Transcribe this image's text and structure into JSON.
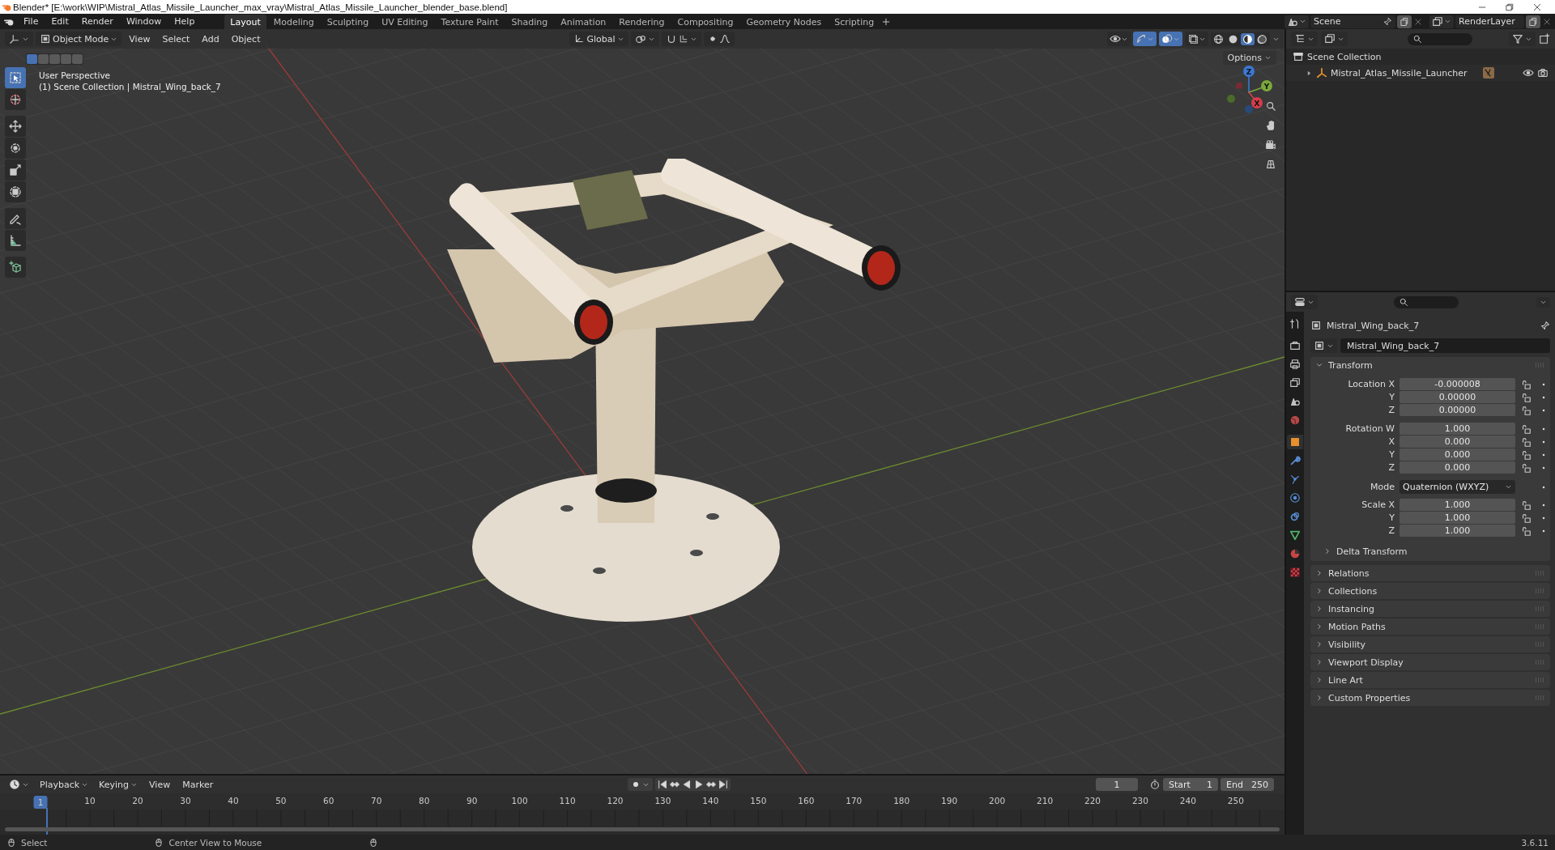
{
  "window": {
    "title": "Blender* [E:\\work\\WIP\\Mistral_Atlas_Missile_Launcher_max_vray\\Mistral_Atlas_Missile_Launcher_blender_base.blend]"
  },
  "menu": [
    "File",
    "Edit",
    "Render",
    "Window",
    "Help"
  ],
  "workspaces": [
    {
      "label": "Layout",
      "selected": true
    },
    {
      "label": "Modeling",
      "selected": false
    },
    {
      "label": "Sculpting",
      "selected": false
    },
    {
      "label": "UV Editing",
      "selected": false
    },
    {
      "label": "Texture Paint",
      "selected": false
    },
    {
      "label": "Shading",
      "selected": false
    },
    {
      "label": "Animation",
      "selected": false
    },
    {
      "label": "Rendering",
      "selected": false
    },
    {
      "label": "Compositing",
      "selected": false
    },
    {
      "label": "Geometry Nodes",
      "selected": false
    },
    {
      "label": "Scripting",
      "selected": false
    }
  ],
  "scene": {
    "name": "Scene"
  },
  "view_layer": {
    "name": "RenderLayer"
  },
  "viewport": {
    "mode": "Object Mode",
    "menus": [
      "View",
      "Select",
      "Add",
      "Object"
    ],
    "orientation": "Global",
    "options": "Options",
    "view_name": "User Perspective",
    "context": "(1) Scene Collection | Mistral_Wing_back_7",
    "select_modes": [
      {
        "selected": true
      },
      {
        "selected": false
      },
      {
        "selected": false
      },
      {
        "selected": false
      },
      {
        "selected": false
      }
    ],
    "tools": [
      {
        "kind": "select",
        "selected": true
      },
      {
        "kind": "cursor",
        "selected": false
      },
      {
        "kind": "move",
        "selected": false
      },
      {
        "kind": "rotate",
        "selected": false
      },
      {
        "kind": "scale",
        "selected": false
      },
      {
        "kind": "transform",
        "selected": false
      },
      {
        "kind": "annotate",
        "selected": false
      },
      {
        "kind": "measure",
        "selected": false
      },
      {
        "kind": "add-cube",
        "selected": false
      }
    ],
    "toggles": [
      {
        "kind": "visibility",
        "on": false
      },
      {
        "kind": "gizmo",
        "on": true
      },
      {
        "kind": "overlays",
        "on": true
      },
      {
        "kind": "xray",
        "on": false
      }
    ],
    "shading": [
      {
        "kind": "wireframe",
        "selected": false
      },
      {
        "kind": "solid",
        "selected": false
      },
      {
        "kind": "material",
        "selected": true
      },
      {
        "kind": "rendered",
        "selected": false
      }
    ],
    "gizmo": [
      "Z",
      "Y",
      "X"
    ]
  },
  "outliner": {
    "root": "Scene Collection",
    "items": [
      {
        "label": "Mistral_Atlas_Missile_Launcher",
        "expanded": false
      }
    ]
  },
  "properties": {
    "tabs": [
      {
        "kind": "tool",
        "selected": false
      },
      {
        "kind": "render",
        "selected": false
      },
      {
        "kind": "output",
        "selected": false
      },
      {
        "kind": "view-layer",
        "selected": false
      },
      {
        "kind": "scene",
        "selected": false
      },
      {
        "kind": "world",
        "selected": false
      },
      {
        "kind": "object",
        "selected": true
      },
      {
        "kind": "modifiers",
        "selected": false
      },
      {
        "kind": "particles",
        "selected": false
      },
      {
        "kind": "physics",
        "selected": false
      },
      {
        "kind": "constraints",
        "selected": false
      },
      {
        "kind": "data",
        "selected": false
      },
      {
        "kind": "material",
        "selected": false
      },
      {
        "kind": "texture",
        "selected": false
      }
    ],
    "object": "Mistral_Wing_back_7",
    "datablock": "Mistral_Wing_back_7",
    "transform": {
      "title": "Transform",
      "expanded": true,
      "groups": [
        [
          {
            "kind": "number",
            "label": "Location X",
            "value": "-0.000008"
          },
          {
            "kind": "number",
            "label": "Y",
            "value": "0.00000"
          },
          {
            "kind": "number",
            "label": "Z",
            "value": "0.00000"
          }
        ],
        [
          {
            "kind": "number",
            "label": "Rotation W",
            "value": "1.000"
          },
          {
            "kind": "number",
            "label": "X",
            "value": "0.000"
          },
          {
            "kind": "number",
            "label": "Y",
            "value": "0.000"
          },
          {
            "kind": "number",
            "label": "Z",
            "value": "0.000"
          }
        ],
        [
          {
            "kind": "dropdown",
            "label": "Mode",
            "value": "Quaternion (WXYZ)"
          }
        ],
        [
          {
            "kind": "number",
            "label": "Scale X",
            "value": "1.000"
          },
          {
            "kind": "number",
            "label": "Y",
            "value": "1.000"
          },
          {
            "kind": "number",
            "label": "Z",
            "value": "1.000"
          }
        ]
      ],
      "subpanels": [
        {
          "title": "Delta Transform",
          "expanded": false
        }
      ]
    },
    "panels": [
      {
        "title": "Relations",
        "expanded": false
      },
      {
        "title": "Collections",
        "expanded": false
      },
      {
        "title": "Instancing",
        "expanded": false
      },
      {
        "title": "Motion Paths",
        "expanded": false
      },
      {
        "title": "Visibility",
        "expanded": false
      },
      {
        "title": "Viewport Display",
        "expanded": false
      },
      {
        "title": "Line Art",
        "expanded": false
      },
      {
        "title": "Custom Properties",
        "expanded": false
      }
    ]
  },
  "timeline": {
    "menus": [
      "Playback",
      "Keying",
      "View",
      "Marker"
    ],
    "current_frame": "1",
    "start_label": "Start",
    "start": "1",
    "end_label": "End",
    "end": "250",
    "playhead": "1",
    "ruler": [
      "10",
      "20",
      "30",
      "40",
      "50",
      "60",
      "70",
      "80",
      "90",
      "100",
      "110",
      "120",
      "130",
      "140",
      "150",
      "160",
      "170",
      "180",
      "190",
      "200",
      "210",
      "220",
      "230",
      "240",
      "250"
    ]
  },
  "status_bar": {
    "hints": [
      "Select",
      "Center View to Mouse"
    ],
    "version": "3.6.11"
  }
}
